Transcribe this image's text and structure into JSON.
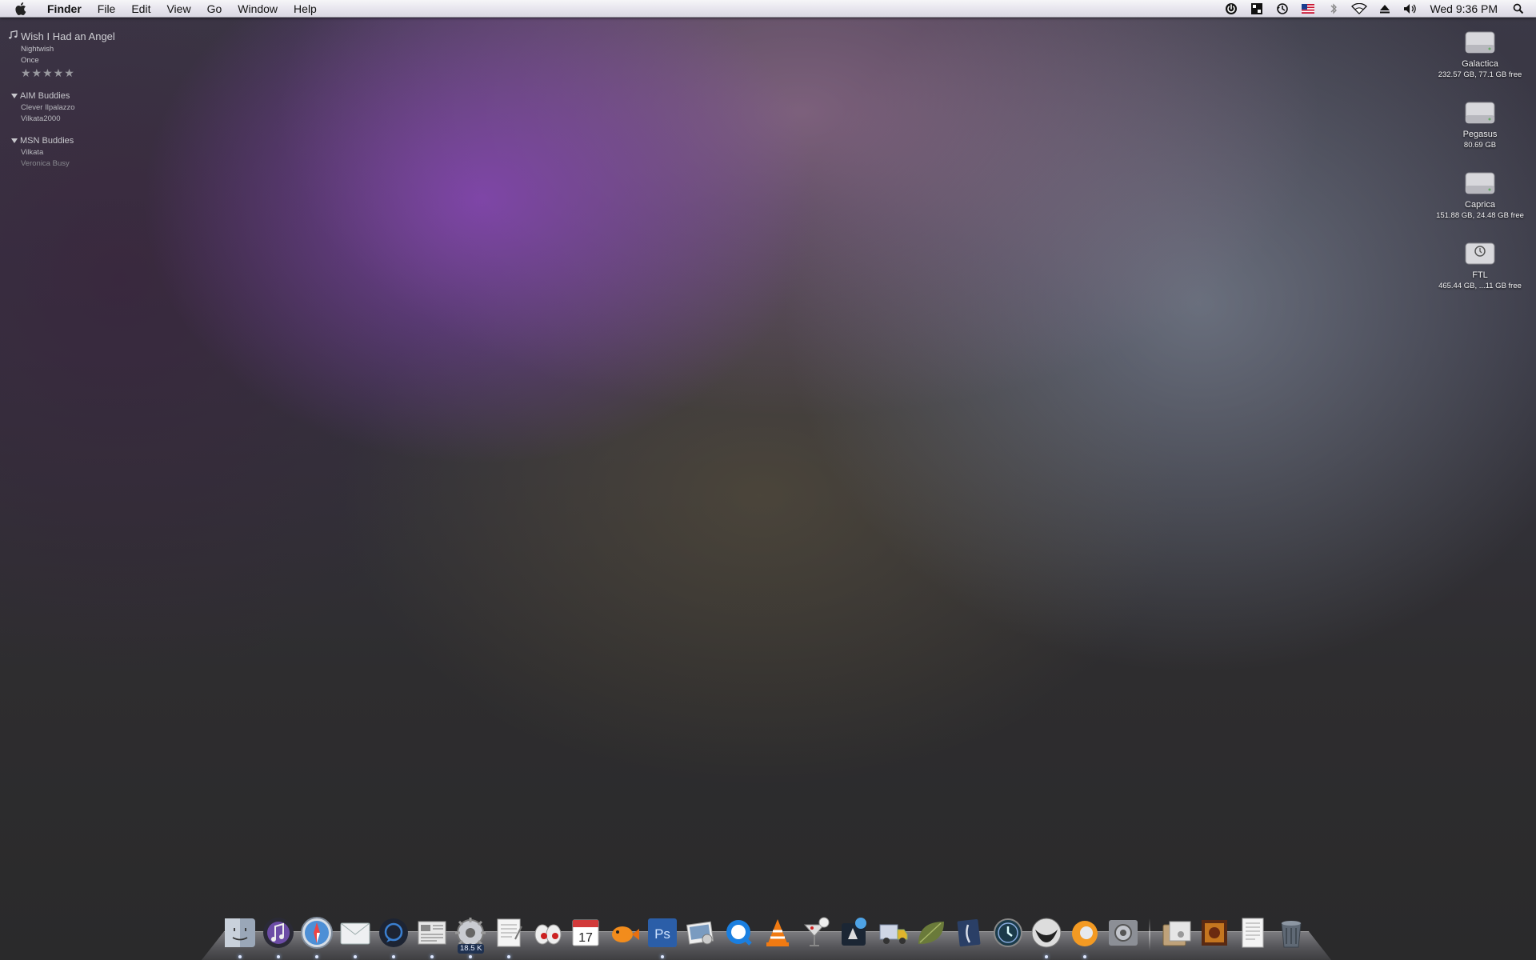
{
  "menubar": {
    "app_name": "Finder",
    "menus": [
      "File",
      "Edit",
      "View",
      "Go",
      "Window",
      "Help"
    ],
    "status_icons": [
      "power-icon",
      "spaces-icon",
      "time-machine-icon",
      "us-flag-icon",
      "bluetooth-icon",
      "wifi-icon",
      "eject-icon",
      "volume-icon"
    ],
    "clock": "Wed 9:36 PM"
  },
  "now_playing": {
    "title": "Wish I Had an Angel",
    "artist": "Nightwish",
    "album": "Once",
    "stars": "★★★★★"
  },
  "aim": {
    "header": "AIM Buddies",
    "buddies": [
      "Clever Ilpalazzo",
      "Vilkata2000"
    ]
  },
  "msn": {
    "header": "MSN Buddies",
    "buddies": [
      "Vilkata",
      "Veronica Busy"
    ]
  },
  "drives": [
    {
      "name": "Galactica",
      "info": "232.57 GB, 77.1 GB free"
    },
    {
      "name": "Pegasus",
      "info": "80.69 GB"
    },
    {
      "name": "Caprica",
      "info": "151.88 GB, 24.48 GB free"
    },
    {
      "name": "FTL",
      "info": "465.44 GB, ...11 GB free"
    }
  ],
  "dock": {
    "badge": "18.5 K",
    "calendar_day": "17",
    "photoshop_label": "Ps"
  }
}
